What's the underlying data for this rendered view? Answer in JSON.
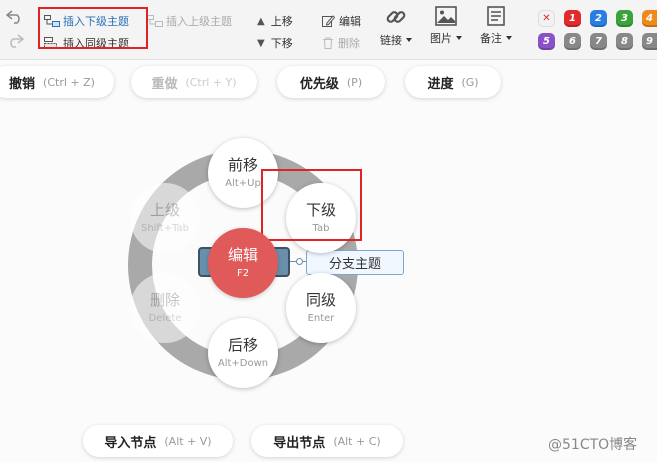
{
  "toolbar": {
    "insert_child": "插入下级主题",
    "insert_parent": "插入上级主题",
    "insert_sibling": "插入同级主题",
    "move_up": "上移",
    "move_down": "下移",
    "edit": "编辑",
    "delete": "删除",
    "link": "链接",
    "image": "图片",
    "note": "备注",
    "priorities": [
      {
        "label": "1",
        "color": "#e02b2b"
      },
      {
        "label": "2",
        "color": "#2a7de1"
      },
      {
        "label": "3",
        "color": "#3aa33a"
      },
      {
        "label": "4",
        "color": "#f08a1c"
      },
      {
        "label": "5",
        "color": "#8a52c9"
      },
      {
        "label": "6",
        "color": "#888888"
      },
      {
        "label": "7",
        "color": "#888888"
      },
      {
        "label": "8",
        "color": "#888888"
      },
      {
        "label": "9",
        "color": "#888888"
      }
    ]
  },
  "shortcuts": {
    "undo": {
      "name": "撤销",
      "key": "(Ctrl + Z)"
    },
    "redo": {
      "name": "重做",
      "key": "(Ctrl + Y)"
    },
    "priority": {
      "name": "优先级",
      "key": "(P)"
    },
    "progress": {
      "name": "进度",
      "key": "(G)"
    },
    "import": {
      "name": "导入节点",
      "key": "(Alt + V)"
    },
    "export": {
      "name": "导出节点",
      "key": "(Alt + C)"
    }
  },
  "radial": {
    "forward": {
      "label": "前移",
      "key": "Alt+Up"
    },
    "parent": {
      "label": "上级",
      "key": "Shift+Tab"
    },
    "child": {
      "label": "下级",
      "key": "Tab"
    },
    "edit": {
      "label": "编辑",
      "key": "F2"
    },
    "delete": {
      "label": "删除",
      "key": "Delete"
    },
    "sibling": {
      "label": "同级",
      "key": "Enter"
    },
    "backward": {
      "label": "后移",
      "key": "Alt+Down"
    }
  },
  "branch_topic": "分支主题",
  "watermark": "@51CTO博客",
  "colors": {
    "accent_red": "#e05a5a",
    "highlight_box": "#e02424",
    "topic_fill": "#6a8faa"
  }
}
